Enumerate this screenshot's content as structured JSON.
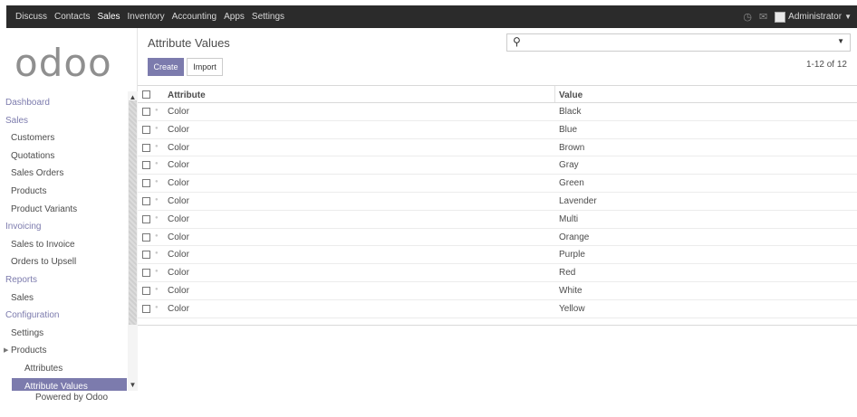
{
  "topbar": {
    "menu": [
      "Discuss",
      "Contacts",
      "Sales",
      "Inventory",
      "Accounting",
      "Apps",
      "Settings"
    ],
    "active_menu": "Sales",
    "user": "Administrator"
  },
  "sidebar": {
    "logo": "odoo",
    "sections": [
      {
        "label": "Dashboard",
        "kind": "section"
      },
      {
        "label": "Sales",
        "kind": "section"
      },
      {
        "label": "Customers",
        "kind": "item"
      },
      {
        "label": "Quotations",
        "kind": "item"
      },
      {
        "label": "Sales Orders",
        "kind": "item"
      },
      {
        "label": "Products",
        "kind": "item"
      },
      {
        "label": "Product Variants",
        "kind": "item"
      },
      {
        "label": "Invoicing",
        "kind": "section"
      },
      {
        "label": "Sales to Invoice",
        "kind": "item"
      },
      {
        "label": "Orders to Upsell",
        "kind": "item"
      },
      {
        "label": "Reports",
        "kind": "section"
      },
      {
        "label": "Sales",
        "kind": "item"
      },
      {
        "label": "Configuration",
        "kind": "section"
      },
      {
        "label": "Settings",
        "kind": "item"
      },
      {
        "label": "Products",
        "kind": "expand"
      },
      {
        "label": "Attributes",
        "kind": "sub"
      },
      {
        "label": "Attribute Values",
        "kind": "sub-active"
      }
    ],
    "powered_by": "Powered by Odoo"
  },
  "main": {
    "title": "Attribute Values",
    "create_label": "Create",
    "import_label": "Import",
    "pager": "1-12 of 12",
    "columns": {
      "attribute": "Attribute",
      "value": "Value"
    },
    "rows": [
      {
        "attribute": "Color",
        "value": "Black"
      },
      {
        "attribute": "Color",
        "value": "Blue"
      },
      {
        "attribute": "Color",
        "value": "Brown"
      },
      {
        "attribute": "Color",
        "value": "Gray"
      },
      {
        "attribute": "Color",
        "value": "Green"
      },
      {
        "attribute": "Color",
        "value": "Lavender"
      },
      {
        "attribute": "Color",
        "value": "Multi"
      },
      {
        "attribute": "Color",
        "value": "Orange"
      },
      {
        "attribute": "Color",
        "value": "Purple"
      },
      {
        "attribute": "Color",
        "value": "Red"
      },
      {
        "attribute": "Color",
        "value": "White"
      },
      {
        "attribute": "Color",
        "value": "Yellow"
      }
    ]
  },
  "colors": {
    "accent": "#7c7bad",
    "topbar": "#2b2b2b"
  }
}
